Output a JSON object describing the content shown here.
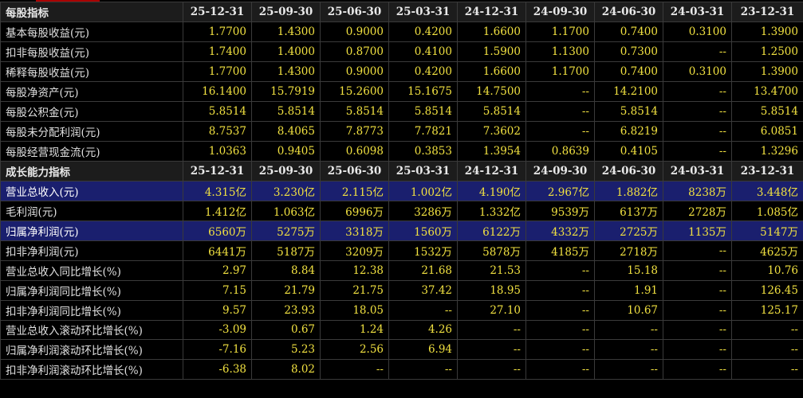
{
  "columns": [
    "25-12-31",
    "25-09-30",
    "25-06-30",
    "25-03-31",
    "24-12-31",
    "24-09-30",
    "24-06-30",
    "24-03-31",
    "23-12-31"
  ],
  "sections": [
    {
      "title": "每股指标",
      "rows": [
        {
          "label": "基本每股收益(元)",
          "values": [
            "1.7700",
            "1.4300",
            "0.9000",
            "0.4200",
            "1.6600",
            "1.1700",
            "0.7400",
            "0.3100",
            "1.3900"
          ]
        },
        {
          "label": "扣非每股收益(元)",
          "values": [
            "1.7400",
            "1.4000",
            "0.8700",
            "0.4100",
            "1.5900",
            "1.1300",
            "0.7300",
            "--",
            "1.2500"
          ]
        },
        {
          "label": "稀释每股收益(元)",
          "values": [
            "1.7700",
            "1.4300",
            "0.9000",
            "0.4200",
            "1.6600",
            "1.1700",
            "0.7400",
            "0.3100",
            "1.3900"
          ]
        },
        {
          "label": "每股净资产(元)",
          "values": [
            "16.1400",
            "15.7919",
            "15.2600",
            "15.1675",
            "14.7500",
            "--",
            "14.2100",
            "--",
            "13.4700"
          ]
        },
        {
          "label": "每股公积金(元)",
          "values": [
            "5.8514",
            "5.8514",
            "5.8514",
            "5.8514",
            "5.8514",
            "--",
            "5.8514",
            "--",
            "5.8514"
          ]
        },
        {
          "label": "每股未分配利润(元)",
          "values": [
            "8.7537",
            "8.4065",
            "7.8773",
            "7.7821",
            "7.3602",
            "--",
            "6.8219",
            "--",
            "6.0851"
          ]
        },
        {
          "label": "每股经营现金流(元)",
          "values": [
            "1.0363",
            "0.9405",
            "0.6098",
            "0.3853",
            "1.3954",
            "0.8639",
            "0.4105",
            "--",
            "1.3296"
          ]
        }
      ]
    },
    {
      "title": "成长能力指标",
      "rows": [
        {
          "label": "营业总收入(元)",
          "highlight": true,
          "values": [
            "4.315亿",
            "3.230亿",
            "2.115亿",
            "1.002亿",
            "4.190亿",
            "2.967亿",
            "1.882亿",
            "8238万",
            "3.448亿"
          ]
        },
        {
          "label": "毛利润(元)",
          "values": [
            "1.412亿",
            "1.063亿",
            "6996万",
            "3286万",
            "1.332亿",
            "9539万",
            "6137万",
            "2728万",
            "1.085亿"
          ]
        },
        {
          "label": "归属净利润(元)",
          "highlight": true,
          "values": [
            "6560万",
            "5275万",
            "3318万",
            "1560万",
            "6122万",
            "4332万",
            "2725万",
            "1135万",
            "5147万"
          ]
        },
        {
          "label": "扣非净利润(元)",
          "values": [
            "6441万",
            "5187万",
            "3209万",
            "1532万",
            "5878万",
            "4185万",
            "2718万",
            "--",
            "4625万"
          ]
        },
        {
          "label": "营业总收入同比增长(%)",
          "values": [
            "2.97",
            "8.84",
            "12.38",
            "21.68",
            "21.53",
            "--",
            "15.18",
            "--",
            "10.76"
          ]
        },
        {
          "label": "归属净利润同比增长(%)",
          "values": [
            "7.15",
            "21.79",
            "21.75",
            "37.42",
            "18.95",
            "--",
            "1.91",
            "--",
            "126.45"
          ]
        },
        {
          "label": "扣非净利润同比增长(%)",
          "values": [
            "9.57",
            "23.93",
            "18.05",
            "--",
            "27.10",
            "--",
            "10.67",
            "--",
            "125.17"
          ]
        },
        {
          "label": "营业总收入滚动环比增长(%)",
          "values": [
            "-3.09",
            "0.67",
            "1.24",
            "4.26",
            "--",
            "--",
            "--",
            "--",
            "--"
          ]
        },
        {
          "label": "归属净利润滚动环比增长(%)",
          "values": [
            "-7.16",
            "5.23",
            "2.56",
            "6.94",
            "--",
            "--",
            "--",
            "--",
            "--"
          ]
        },
        {
          "label": "扣非净利润滚动环比增长(%)",
          "values": [
            "-6.38",
            "8.02",
            "--",
            "--",
            "--",
            "--",
            "--",
            "--",
            "--"
          ]
        }
      ]
    }
  ]
}
